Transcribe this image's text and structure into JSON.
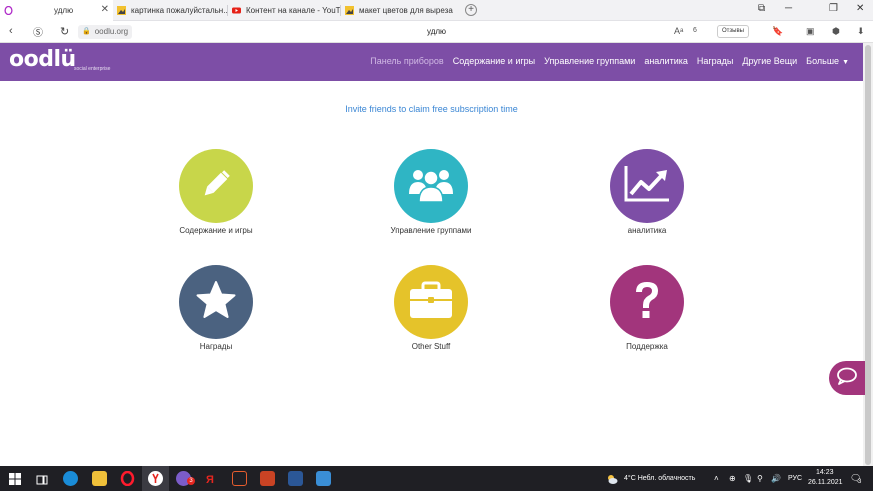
{
  "browser": {
    "tabs": [
      {
        "title": "удлю",
        "active": true
      },
      {
        "title": "картинка пожалуйстальн...",
        "active": false
      },
      {
        "title": "Контент на канале - YouTu...",
        "active": false
      },
      {
        "title": "макет цветов для вырезан...",
        "active": false
      }
    ],
    "url": "oodlu.org",
    "page_title": "удлю",
    "reviews_label": "Отзывы",
    "badge_count": "6"
  },
  "site": {
    "logo": "oodlü",
    "tagline": "social enterprise",
    "nav": [
      "Панель приборов",
      "Содержание и игры",
      "Управление группами",
      "аналитика",
      "Награды",
      "Другие Вещи",
      "Больше"
    ],
    "invite_link": "Invite friends to claim free subscription time",
    "tiles": [
      {
        "label": "Содержание и игры",
        "color": "#c8d64a",
        "icon": "pencil-icon"
      },
      {
        "label": "Управление группами",
        "color": "#2fb5c4",
        "icon": "group-icon"
      },
      {
        "label": "аналитика",
        "color": "#7d4ea6",
        "icon": "chart-icon"
      },
      {
        "label": "Награды",
        "color": "#4b6280",
        "icon": "star-icon"
      },
      {
        "label": "Other Stuff",
        "color": "#e5c32a",
        "icon": "briefcase-icon"
      },
      {
        "label": "Поддержка",
        "color": "#a2357c",
        "icon": "question-icon"
      }
    ]
  },
  "taskbar": {
    "weather": "4°C  Небл. облачность",
    "lang": "РУС",
    "time": "14:23",
    "date": "26.11.2021",
    "notif_count": "3"
  },
  "colors": {
    "header_purple": "#7d4ea6",
    "link_blue": "#3a86d4",
    "chat_pink": "#a2357c"
  }
}
